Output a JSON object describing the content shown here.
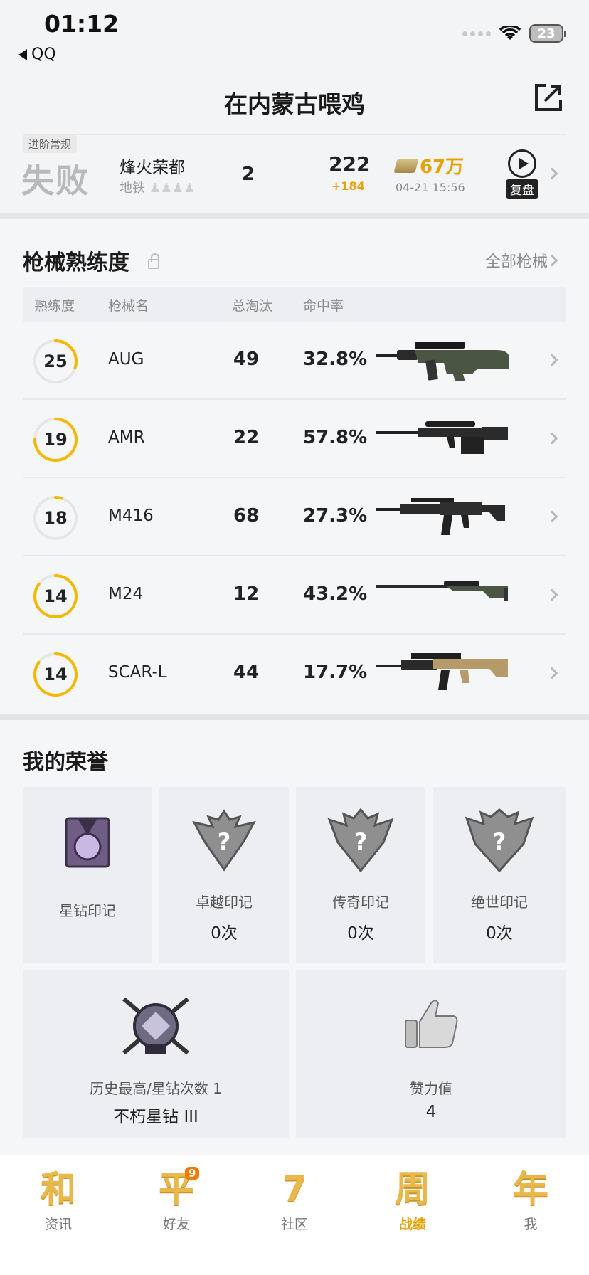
{
  "status": {
    "time": "01:12",
    "back_label": "QQ",
    "battery": "23"
  },
  "header": {
    "title": "在内蒙古喂鸡"
  },
  "match": {
    "mode_tag": "进阶常规",
    "result": "失败",
    "map": "烽火荣都",
    "map_sub": "地铁",
    "rank": "2",
    "score": "222",
    "score_delta": "+184",
    "coins": "67万",
    "time": "04-21 15:56",
    "replay_label": "复盘"
  },
  "weapons": {
    "title": "枪械熟练度",
    "all_link": "全部枪械",
    "columns": [
      "熟练度",
      "枪械名",
      "总淘汰",
      "命中率"
    ],
    "rows": [
      {
        "level": "25",
        "name": "AUG",
        "kills": "49",
        "accuracy": "32.8%",
        "progress": 0.3
      },
      {
        "level": "19",
        "name": "AMR",
        "kills": "22",
        "accuracy": "57.8%",
        "progress": 0.75
      },
      {
        "level": "18",
        "name": "M416",
        "kills": "68",
        "accuracy": "27.3%",
        "progress": 0.05
      },
      {
        "level": "14",
        "name": "M24",
        "kills": "12",
        "accuracy": "43.2%",
        "progress": 0.85
      },
      {
        "level": "14",
        "name": "SCAR-L",
        "kills": "44",
        "accuracy": "17.7%",
        "progress": 0.85
      }
    ]
  },
  "honors": {
    "title": "我的荣誉",
    "marks": [
      {
        "label": "星钻印记",
        "count": ""
      },
      {
        "label": "卓越印记",
        "count": "0次"
      },
      {
        "label": "传奇印记",
        "count": "0次"
      },
      {
        "label": "绝世印记",
        "count": "0次"
      }
    ],
    "history_label": "历史最高/星钻次数 1",
    "history_value": "不朽星钻 III",
    "likes_label": "赞力值",
    "likes_value": "4"
  },
  "nav": {
    "items": [
      {
        "glyph": "和",
        "label": "资讯"
      },
      {
        "glyph": "平",
        "label": "好友",
        "badge": "9"
      },
      {
        "glyph": "7",
        "label": "社区"
      },
      {
        "glyph": "周",
        "label": "战绩"
      },
      {
        "glyph": "年",
        "label": "我"
      }
    ]
  },
  "colors": {
    "accent": "#f5b800",
    "ring_track": "#e6e6e6"
  }
}
